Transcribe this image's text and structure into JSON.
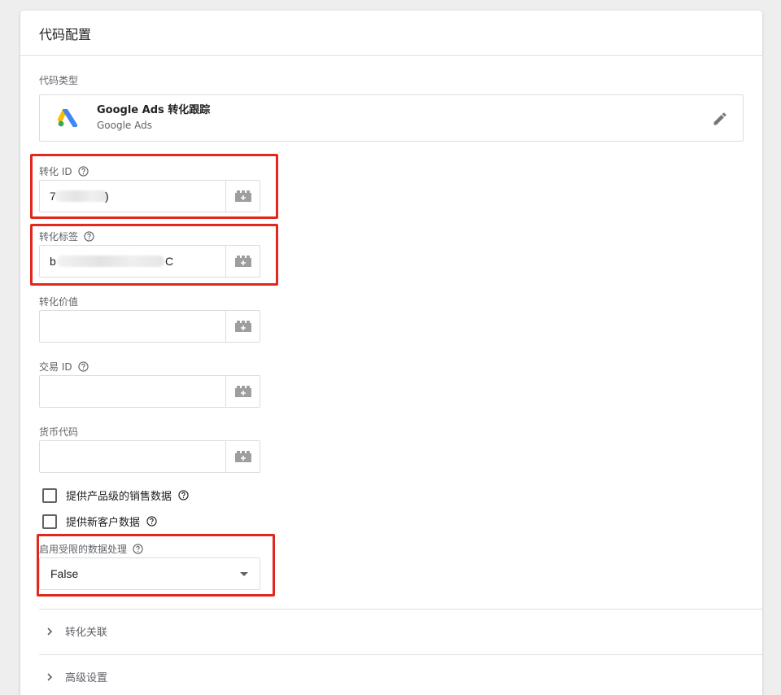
{
  "card": {
    "title": "代码配置"
  },
  "tag_type": {
    "label": "代码类型",
    "name": "Google Ads 转化跟踪",
    "subtitle": "Google Ads",
    "logo_icon": "google-ads-logo",
    "edit_icon": "pencil-icon"
  },
  "fields": {
    "conversion_id": {
      "label": "转化 ID",
      "value": "7",
      "value_tail": ")",
      "has_help": true
    },
    "conversion_label": {
      "label": "转化标签",
      "value": "b",
      "value_tail": "C",
      "has_help": true
    },
    "conversion_value": {
      "label": "转化价值",
      "value": "",
      "has_help": false
    },
    "transaction_id": {
      "label": "交易 ID",
      "value": "",
      "has_help": true
    },
    "currency_code": {
      "label": "货币代码",
      "value": "",
      "has_help": false
    }
  },
  "checkboxes": [
    {
      "label": "提供产品级的销售数据",
      "checked": false
    },
    {
      "label": "提供新客户数据",
      "checked": false
    }
  ],
  "restricted_data": {
    "label": "启用受限的数据处理",
    "selected": "False"
  },
  "sections": [
    {
      "label": "转化关联"
    },
    {
      "label": "高级设置"
    }
  ],
  "colors": {
    "highlight": "#e0281f",
    "ads_blue": "#4285f4",
    "ads_yellow": "#fbbc04",
    "ads_green": "#34a853"
  }
}
